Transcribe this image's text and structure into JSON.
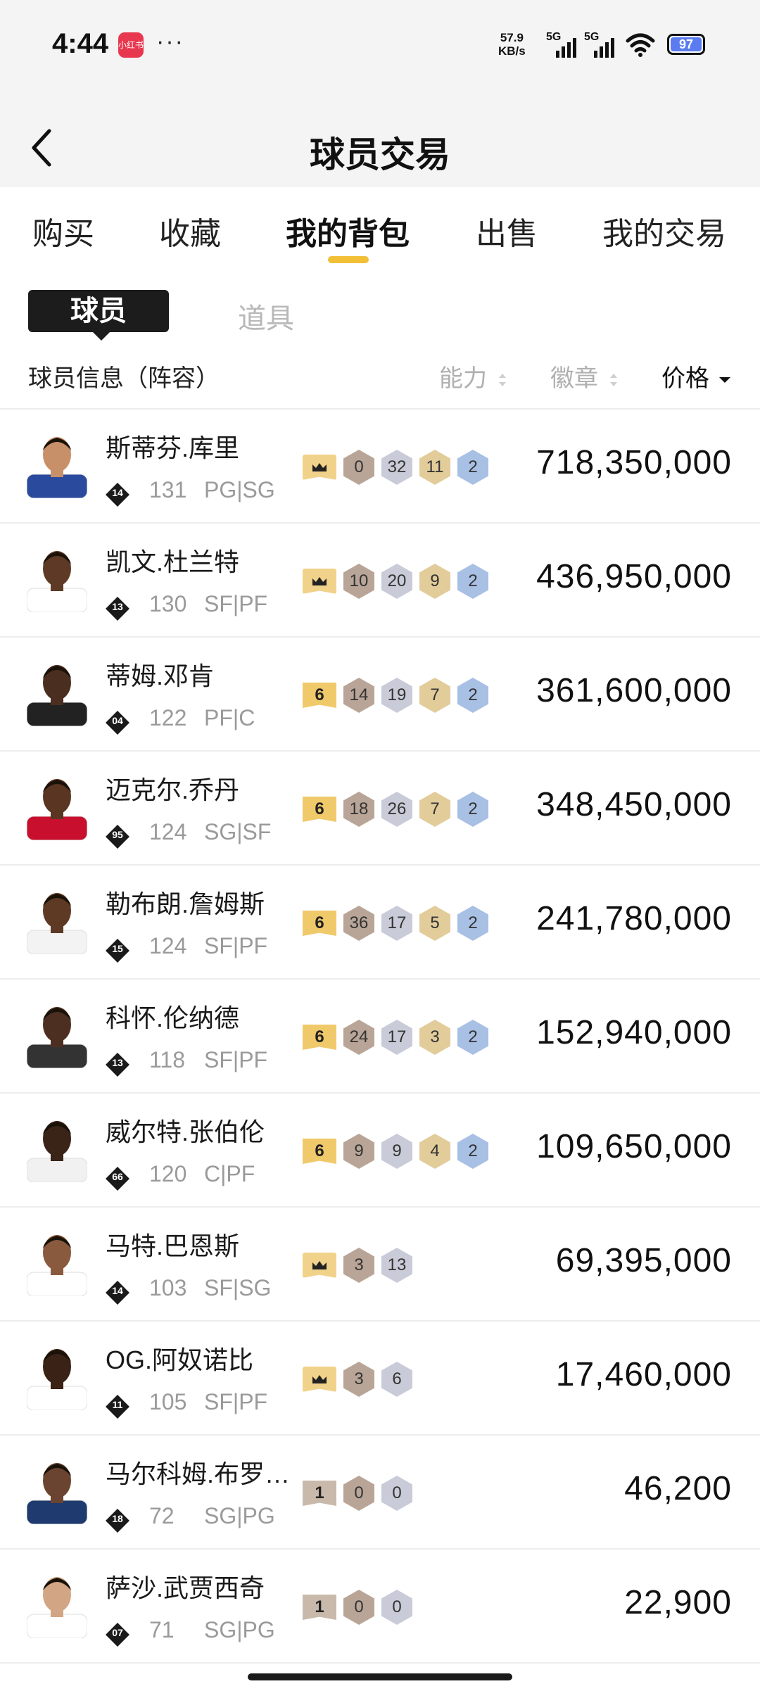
{
  "status": {
    "time": "4:44",
    "app_icon_text": "小红书",
    "dots": "···",
    "speed": "57.9",
    "speed_unit": "KB/s",
    "net1": "5G",
    "net2": "5G",
    "battery": "97"
  },
  "header": {
    "title": "球员交易"
  },
  "tabs": [
    {
      "label": "购买"
    },
    {
      "label": "收藏"
    },
    {
      "label": "我的背包"
    },
    {
      "label": "出售"
    },
    {
      "label": "我的交易"
    }
  ],
  "subtabs": {
    "active": "球员",
    "inactive": "道具"
  },
  "columns": {
    "info": "球员信息（阵容）",
    "ability": "能力",
    "badge": "徽章",
    "price": "价格"
  },
  "players": [
    {
      "name": "斯蒂芬.库里",
      "level": "14",
      "ovr": "131",
      "pos": "PG|SG",
      "tier": "crown",
      "hexes": [
        "0",
        "32",
        "11",
        "2"
      ],
      "price": "718,350,000",
      "skin": "#c89068",
      "jersey": "#2a4a9e"
    },
    {
      "name": "凯文.杜兰特",
      "level": "13",
      "ovr": "130",
      "pos": "SF|PF",
      "tier": "crown",
      "hexes": [
        "10",
        "20",
        "9",
        "2"
      ],
      "price": "436,950,000",
      "skin": "#5e3a26",
      "jersey": "#ffffff"
    },
    {
      "name": "蒂姆.邓肯",
      "level": "04",
      "ovr": "122",
      "pos": "PF|C",
      "tier": "6",
      "hexes": [
        "14",
        "19",
        "7",
        "2"
      ],
      "price": "361,600,000",
      "skin": "#4a2e20",
      "jersey": "#222222"
    },
    {
      "name": "迈克尔.乔丹",
      "level": "95",
      "ovr": "124",
      "pos": "SG|SF",
      "tier": "6",
      "hexes": [
        "18",
        "26",
        "7",
        "2"
      ],
      "price": "348,450,000",
      "skin": "#5a3522",
      "jersey": "#c8102e"
    },
    {
      "name": "勒布朗.詹姆斯",
      "level": "15",
      "ovr": "124",
      "pos": "SF|PF",
      "tier": "6",
      "hexes": [
        "36",
        "17",
        "5",
        "2"
      ],
      "price": "241,780,000",
      "skin": "#5e3a24",
      "jersey": "#f3f3f3"
    },
    {
      "name": "科怀.伦纳德",
      "level": "13",
      "ovr": "118",
      "pos": "SF|PF",
      "tier": "6",
      "hexes": [
        "24",
        "17",
        "3",
        "2"
      ],
      "price": "152,940,000",
      "skin": "#4d2f22",
      "jersey": "#333333"
    },
    {
      "name": "威尔特.张伯伦",
      "level": "66",
      "ovr": "120",
      "pos": "C|PF",
      "tier": "6",
      "hexes": [
        "9",
        "9",
        "4",
        "2"
      ],
      "price": "109,650,000",
      "skin": "#3a2418",
      "jersey": "#f1f1f1"
    },
    {
      "name": "马特.巴恩斯",
      "level": "14",
      "ovr": "103",
      "pos": "SF|SG",
      "tier": "crown",
      "hexes": [
        "3",
        "13"
      ],
      "price": "69,395,000",
      "skin": "#8a5a3e",
      "jersey": "#ffffff"
    },
    {
      "name": "OG.阿奴诺比",
      "level": "11",
      "ovr": "105",
      "pos": "SF|PF",
      "tier": "crown",
      "hexes": [
        "3",
        "6"
      ],
      "price": "17,460,000",
      "skin": "#3a2216",
      "jersey": "#ffffff"
    },
    {
      "name": "马尔科姆.布罗…",
      "level": "18",
      "ovr": "72",
      "pos": "SG|PG",
      "tier": "1",
      "hexes": [
        "0",
        "0"
      ],
      "price": "46,200",
      "skin": "#6a4430",
      "jersey": "#1e3a6e"
    },
    {
      "name": "萨沙.武贾西奇",
      "level": "07",
      "ovr": "71",
      "pos": "SG|PG",
      "tier": "1",
      "hexes": [
        "0",
        "0"
      ],
      "price": "22,900",
      "skin": "#d2a684",
      "jersey": "#ffffff"
    }
  ]
}
